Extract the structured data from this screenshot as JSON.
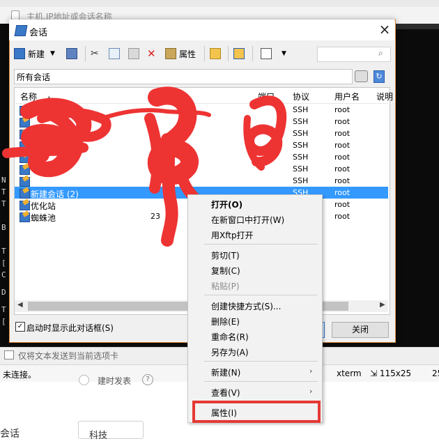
{
  "background": {
    "address_placeholder": "主机,IP地址或会话名称",
    "send_text": "仅将文本发送到当前选项卡",
    "status_left": "未连接。",
    "status_term": "xterm",
    "status_size": "115x25",
    "status_more": "25",
    "setting_label": "建时发表",
    "left_label": "会话",
    "select_value": "科技",
    "terminal_chars": [
      "N",
      "T",
      "T",
      "B",
      "T",
      "[",
      "C",
      "D",
      "T",
      "["
    ]
  },
  "dialog": {
    "title": "会话",
    "close_glyph": "×",
    "toolbar": {
      "new_label": "新建",
      "properties_label": "属性"
    },
    "path": "所有会话",
    "columns": {
      "name": "名称",
      "host": "主机",
      "port": "端口",
      "protocol": "协议",
      "user": "用户名",
      "desc": "说明"
    },
    "rows": [
      {
        "name": "",
        "host": "",
        "port": "",
        "protocol": "SSH",
        "user": "root"
      },
      {
        "name": "",
        "host": "",
        "port": "",
        "protocol": "SSH",
        "user": "root"
      },
      {
        "name": "",
        "host": "",
        "port": "",
        "protocol": "SSH",
        "user": "root"
      },
      {
        "name": "",
        "host": "",
        "port": "",
        "protocol": "SSH",
        "user": "root"
      },
      {
        "name": "",
        "host": "",
        "port": "",
        "protocol": "SSH",
        "user": "root"
      },
      {
        "name": "",
        "host": "",
        "port": "",
        "protocol": "SSH",
        "user": "root"
      },
      {
        "name": "",
        "host": "",
        "port": "",
        "protocol": "SSH",
        "user": "root"
      },
      {
        "name": "新建会话 (2)",
        "host": "",
        "port": "",
        "protocol": "SSH",
        "user": "root"
      },
      {
        "name": "优化站",
        "host": "",
        "port": "",
        "protocol": "",
        "user": "root"
      },
      {
        "name": "蜘蛛池",
        "host": "23",
        "port": "",
        "protocol": "",
        "user": "root"
      }
    ],
    "startup_label": "启动时显示此对话框(S)",
    "close_button": "关闭"
  },
  "context_menu": {
    "items": [
      {
        "label": "打开(O)"
      },
      {
        "label": "在新窗口中打开(W)"
      },
      {
        "label": "用Xftp打开"
      },
      {
        "label": "剪切(T)"
      },
      {
        "label": "复制(C)"
      },
      {
        "label": "粘贴(P)"
      },
      {
        "label": "创建快捷方式(S)..."
      },
      {
        "label": "删除(E)"
      },
      {
        "label": "重命名(R)"
      },
      {
        "label": "另存为(A)"
      },
      {
        "label": "新建(N)"
      },
      {
        "label": "查看(V)"
      },
      {
        "label": "属性(I)"
      }
    ],
    "submenu_arrow": "›"
  },
  "colors": {
    "selection": "#3399ff",
    "scribble": "#ee3333",
    "highlight_box": "#e53935",
    "dialog_border": "#e28c3a"
  }
}
